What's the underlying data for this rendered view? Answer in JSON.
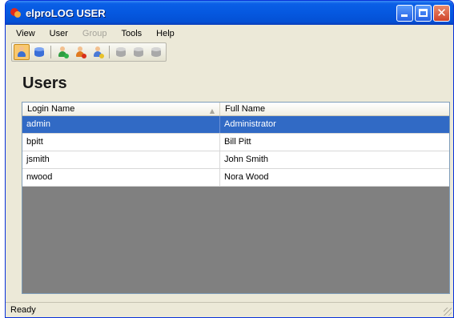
{
  "window": {
    "title": "elproLOG USER"
  },
  "menu": [
    {
      "label": "View",
      "enabled": true
    },
    {
      "label": "User",
      "enabled": true
    },
    {
      "label": "Group",
      "enabled": false
    },
    {
      "label": "Tools",
      "enabled": true
    },
    {
      "label": "Help",
      "enabled": true
    }
  ],
  "toolbar": {
    "buttons": [
      {
        "icon": "users-icon",
        "active": true
      },
      {
        "icon": "database-icon",
        "active": false
      },
      {
        "icon": "add-user-icon",
        "active": false
      },
      {
        "icon": "delete-user-icon",
        "active": false
      },
      {
        "icon": "edit-user-icon",
        "active": false
      },
      {
        "icon": "add-group-icon",
        "disabled": true
      },
      {
        "icon": "delete-group-icon",
        "disabled": true
      },
      {
        "icon": "edit-group-icon",
        "disabled": true
      }
    ]
  },
  "page": {
    "title": "Users"
  },
  "grid": {
    "columns": [
      "Login Name",
      "Full Name"
    ],
    "sorted_column": "Login Name",
    "rows": [
      {
        "login": "admin",
        "full_name": "Administrator",
        "selected": true
      },
      {
        "login": "bpitt",
        "full_name": "Bill Pitt",
        "selected": false
      },
      {
        "login": "jsmith",
        "full_name": "John Smith",
        "selected": false
      },
      {
        "login": "nwood",
        "full_name": "Nora Wood",
        "selected": false
      }
    ]
  },
  "status": {
    "text": "Ready"
  },
  "colors": {
    "selection": "#316ac5",
    "titlebar": "#0558e0",
    "grid_empty": "#808080"
  }
}
